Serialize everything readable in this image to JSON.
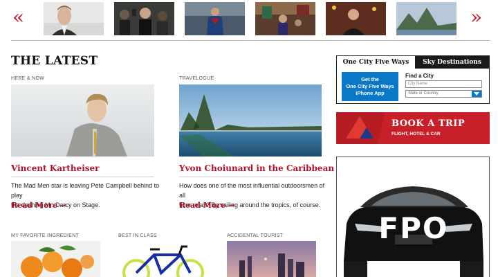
{
  "carousel": {
    "prev_label": "«",
    "next_label": "»",
    "thumbnails": [
      {
        "name": "celebrity-portrait"
      },
      {
        "name": "red-carpet-crowd"
      },
      {
        "name": "superhero-still"
      },
      {
        "name": "festival-street"
      },
      {
        "name": "talk-show-host"
      },
      {
        "name": "mountain-coast"
      }
    ]
  },
  "section_title": "THE LATEST",
  "articles": [
    {
      "kicker": "HERE & NOW",
      "title": "Vincent Kartheiser",
      "description_line1": "The Mad Men star is leaving Pete Campbell behind to play",
      "description_line2": "the dashing Mr. Darcy on Stage.",
      "read_more": "Read More →"
    },
    {
      "kicker": "TRAVELOGUE",
      "title": "Yvon Choiunard in the Caribbean",
      "description_line1": "How does one of the most influential outdoorsmen of all",
      "description_line2": "time relax?  By sailing around the tropics, of course.",
      "read_more": "Read More →"
    }
  ],
  "bottom_row": [
    {
      "kicker": "MY FAVORITE INGREDIENT"
    },
    {
      "kicker": "BEST IN CLASS"
    },
    {
      "kicker": "ACCIDENTAL TOURIST"
    }
  ],
  "widget": {
    "tab_active": "One City Five Ways",
    "tab_inactive": "Sky Destinations",
    "app_button_line1": "Get the",
    "app_button_line2": "One City Five Ways",
    "app_button_line3": "iPhone App",
    "find_label": "Find a City",
    "city_placeholder": "City Name",
    "state_value": "State or Country"
  },
  "book_banner": {
    "title": "BOOK A TRIP",
    "subtitle": "FLIGHT, HOTEL & CAR"
  },
  "ad": {
    "label": "FPO"
  },
  "colors": {
    "accent": "#b0122c",
    "widget_blue": "#0b78c7",
    "banner_red": "#c8202a"
  }
}
